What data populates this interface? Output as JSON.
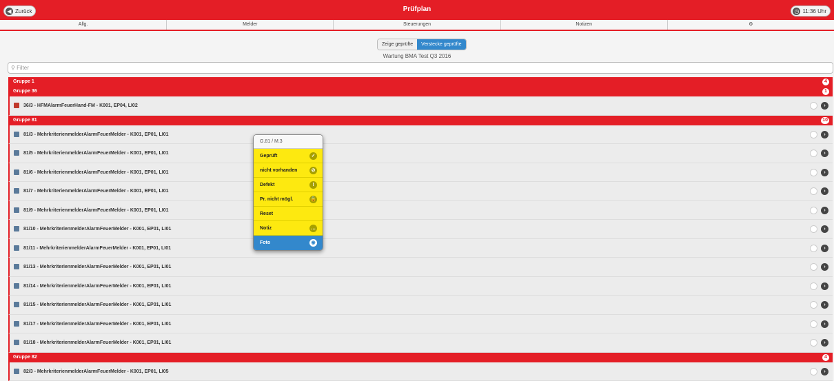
{
  "header": {
    "title": "Prüfplan",
    "back_label": "Zurück",
    "time": "11:36 Uhr"
  },
  "tabs": [
    "Allg.",
    "Melder",
    "Steuerungen",
    "Notizen",
    "⚙"
  ],
  "toggle": {
    "show": "Zeige geprüfte",
    "hide": "Verstecke geprüfte"
  },
  "subtitle": "Wartung BMA Test Q3 2016",
  "filter_placeholder": "Filter",
  "groups": [
    {
      "name": "Gruppe 1",
      "count": "4",
      "items": []
    },
    {
      "name": "Gruppe 36",
      "count": "1",
      "items": [
        "36/3 - HFMAlarmFeuerHand-FM - K001, EP04, LI02"
      ]
    },
    {
      "name": "Gruppe 81",
      "count": "10",
      "items": [
        "81/3 - MehrkriterienmelderAlarmFeuerMelder - K001, EP01, LI01",
        "81/5 - MehrkriterienmelderAlarmFeuerMelder - K001, EP01, LI01",
        "81/6 - MehrkriterienmelderAlarmFeuerMelder - K001, EP01, LI01",
        "81/7 - MehrkriterienmelderAlarmFeuerMelder - K001, EP01, LI01",
        "81/9 - MehrkriterienmelderAlarmFeuerMelder - K001, EP01, LI01",
        "81/10 - MehrkriterienmelderAlarmFeuerMelder - K001, EP01, LI01",
        "81/11 - MehrkriterienmelderAlarmFeuerMelder - K001, EP01, LI01",
        "81/13 - MehrkriterienmelderAlarmFeuerMelder - K001, EP01, LI01",
        "81/14 - MehrkriterienmelderAlarmFeuerMelder - K001, EP01, LI01",
        "81/15 - MehrkriterienmelderAlarmFeuerMelder - K001, EP01, LI01",
        "81/17 - MehrkriterienmelderAlarmFeuerMelder - K001, EP01, LI01",
        "81/18 - MehrkriterienmelderAlarmFeuerMelder - K001, EP01, LI01"
      ]
    },
    {
      "name": "Gruppe 82",
      "count": "4",
      "items": [
        "82/3 - MehrkriterienmelderAlarmFeuerMelder - K001, EP01, LI05"
      ]
    }
  ],
  "popup": {
    "header": "G.81 / M.3",
    "items": [
      {
        "label": "Geprüft",
        "icon": "check-icon"
      },
      {
        "label": "nicht vorhanden",
        "icon": "ban-icon"
      },
      {
        "label": "Defekt",
        "icon": "warning-icon"
      },
      {
        "label": "Pr. nicht mögl.",
        "icon": "lock-icon"
      },
      {
        "label": "Reset",
        "icon": ""
      },
      {
        "label": "Notiz",
        "icon": "comment-icon"
      },
      {
        "label": "Foto",
        "icon": "camera-icon"
      }
    ]
  }
}
